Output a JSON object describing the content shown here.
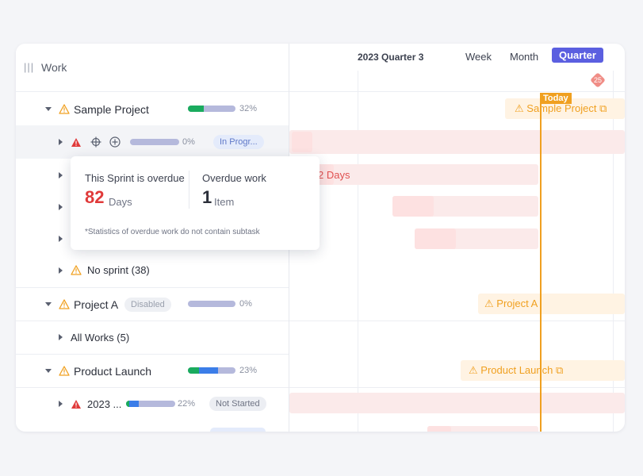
{
  "header": {
    "work_label": "Work"
  },
  "rows": [
    {
      "label": "Sample Project",
      "percent": "32%",
      "progress": 0.32
    },
    {
      "percent": "0%",
      "status": "In Progr...",
      "progress": 0.0
    },
    {
      "label": "No sprint (38)"
    },
    {
      "label": "Project A",
      "badge": "Disabled",
      "percent": "0%",
      "progress": 0.0
    },
    {
      "label": "All Works (5)"
    },
    {
      "label": "Product Launch",
      "percent": "23%",
      "progress": 0.23
    },
    {
      "label": "2023 ...",
      "percent": "22%",
      "status": "Not Started",
      "progress": 0.22
    }
  ],
  "timeline": {
    "period": "2023 Quarter 3",
    "views": [
      "Week",
      "Month",
      "Quarter"
    ],
    "active_view": "Quarter",
    "today_label": "Today",
    "marker_count": "25",
    "overdue_days_label": "2 Days",
    "bar_labels": {
      "sample_project": "Sample Project",
      "project_a": "Project A",
      "product_launch": "Product Launch"
    }
  },
  "popup": {
    "sprint_overdue_label": "This Sprint is overdue",
    "overdue_days": "82",
    "days_unit": "Days",
    "overdue_work_label": "Overdue work",
    "overdue_items": "1",
    "items_unit": "Item",
    "note": "*Statistics of overdue work do not contain subtask"
  },
  "colors": {
    "accent": "#5b5fe0",
    "today": "#f0a020",
    "danger": "#e03a3a",
    "green": "#1aab5e",
    "blue": "#3b7de8",
    "bar_track": "#b5b9dc"
  }
}
